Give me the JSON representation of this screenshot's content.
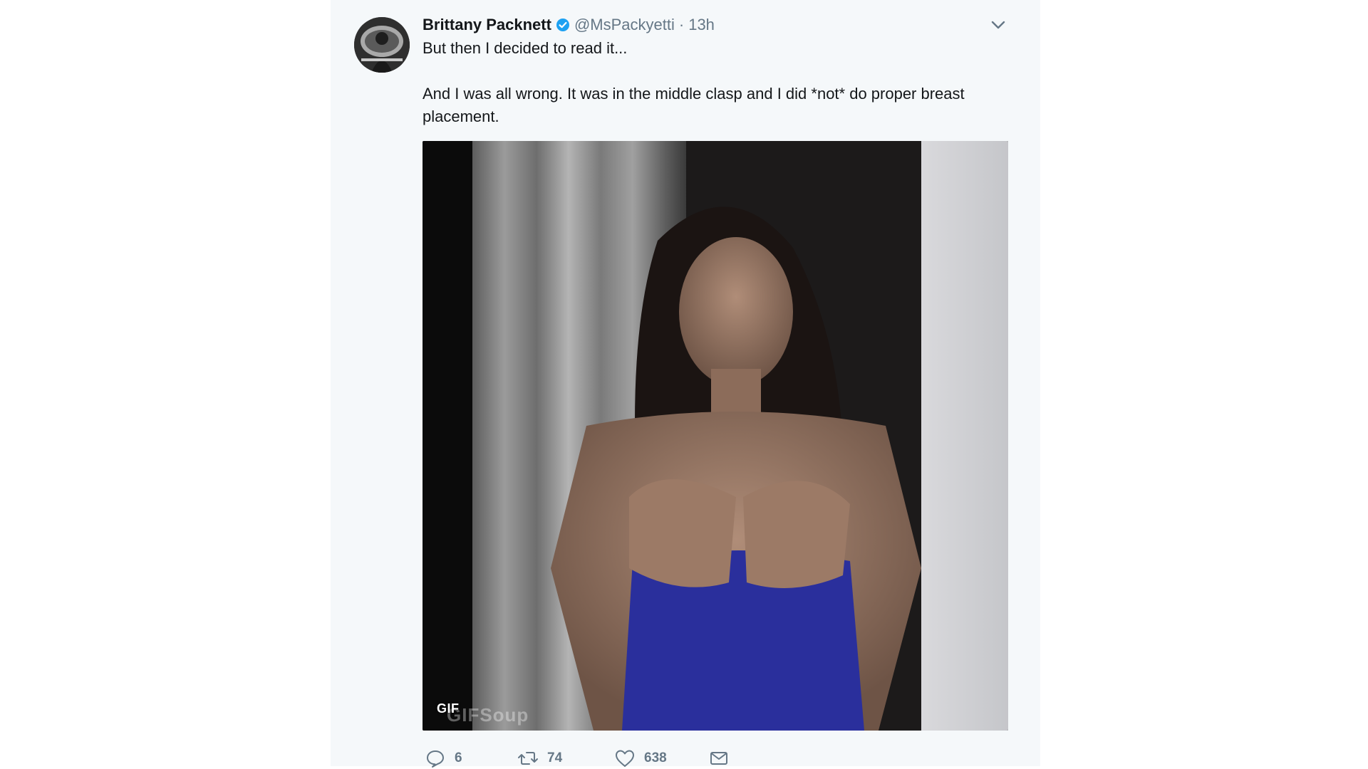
{
  "tweet": {
    "author_name": "Brittany Packnett",
    "handle": "@MsPackyetti",
    "separator": "·",
    "time": "13h",
    "paragraphs": [
      "But then I decided to read it...",
      "And I was all wrong. It was in the middle clasp and I did *not* do proper breast placement."
    ]
  },
  "media": {
    "badge": "GIF",
    "watermark": "GIFSoup"
  },
  "actions": {
    "replies": "6",
    "retweets": "74",
    "likes": "638"
  },
  "colors": {
    "card_bg": "#f5f8fa",
    "text": "#14171a",
    "secondary": "#657786",
    "verified": "#1da1f2",
    "dress": "#2a2f9c"
  }
}
